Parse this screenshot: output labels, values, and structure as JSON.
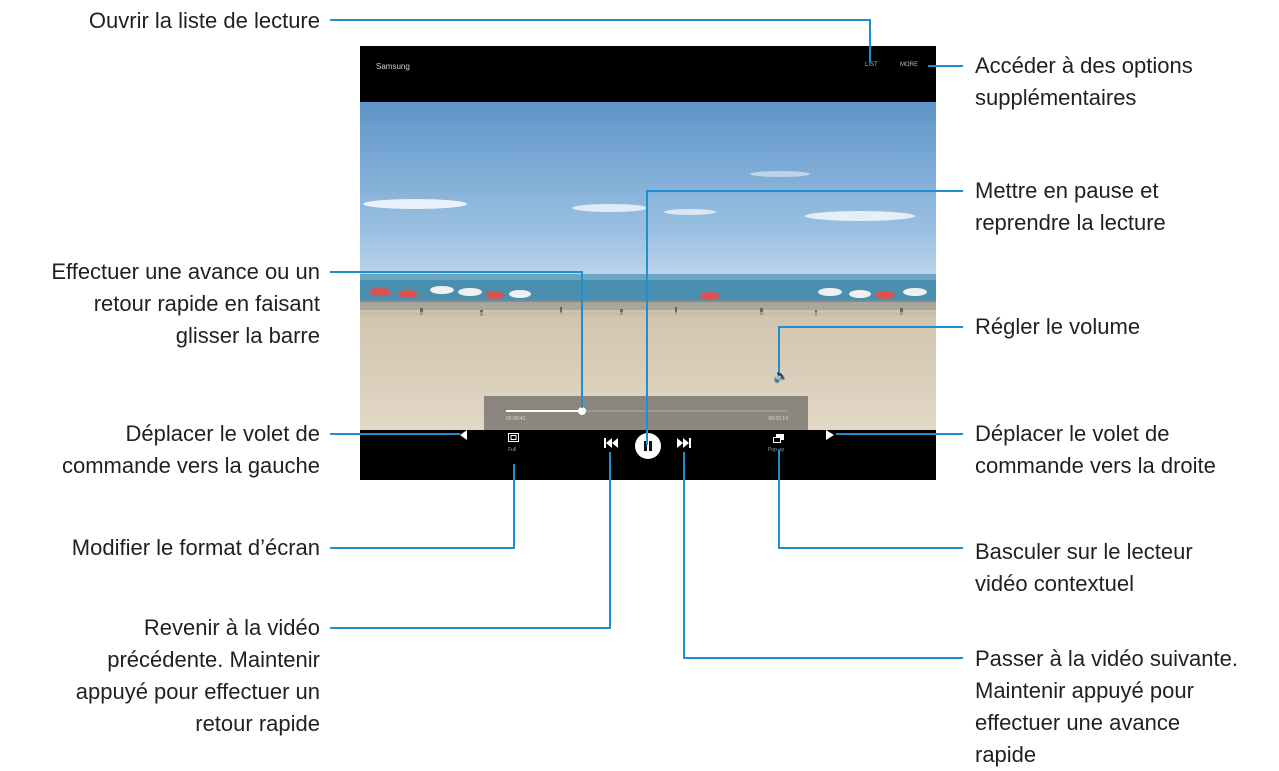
{
  "player": {
    "title": "Samsung",
    "list_label": "LIST",
    "more_label": "MORE",
    "elapsed_time": "00:00:41",
    "total_time": "00:03:14",
    "seek_progress": 0.27,
    "screen_ratio_label": "Full",
    "popup_label": "Pop-up",
    "volume_icon": "speaker-icon",
    "pause_icon": "pause-icon",
    "prev_icon": "skip-previous-icon",
    "next_icon": "skip-next-icon",
    "left_arrow_icon": "arrow-left-icon",
    "right_arrow_icon": "arrow-right-icon"
  },
  "callouts": {
    "playlist": [
      "Ouvrir la liste de lecture"
    ],
    "more_options": [
      "Accéder à des options",
      "supplémentaires"
    ],
    "pause_resume": [
      "Mettre en pause et",
      "reprendre la lecture"
    ],
    "seek": [
      "Effectuer une avance ou un",
      "retour rapide en faisant",
      "glisser la barre"
    ],
    "volume": [
      "Régler le volume"
    ],
    "move_left": [
      "Déplacer le volet de",
      "commande vers la gauche"
    ],
    "move_right": [
      "Déplacer le volet de",
      "commande vers la droite"
    ],
    "screen_ratio": [
      "Modifier le format d’écran"
    ],
    "popup_player": [
      "Basculer sur le lecteur",
      "vidéo contextuel"
    ],
    "previous": [
      "Revenir à la vidéo",
      "précédente. Maintenir",
      "appuyé pour effectuer un",
      "retour rapide"
    ],
    "next": [
      "Passer à la vidéo suivante.",
      "Maintenir appuyé pour",
      "effectuer une avance",
      "rapide"
    ]
  },
  "colors": {
    "leader_line": "#1f8fd1",
    "player_bg": "#000000",
    "sky_top": "#5f94c8",
    "sea": "#4a8fb0",
    "sand": "#d9cdb9",
    "label_text": "#231f20"
  }
}
